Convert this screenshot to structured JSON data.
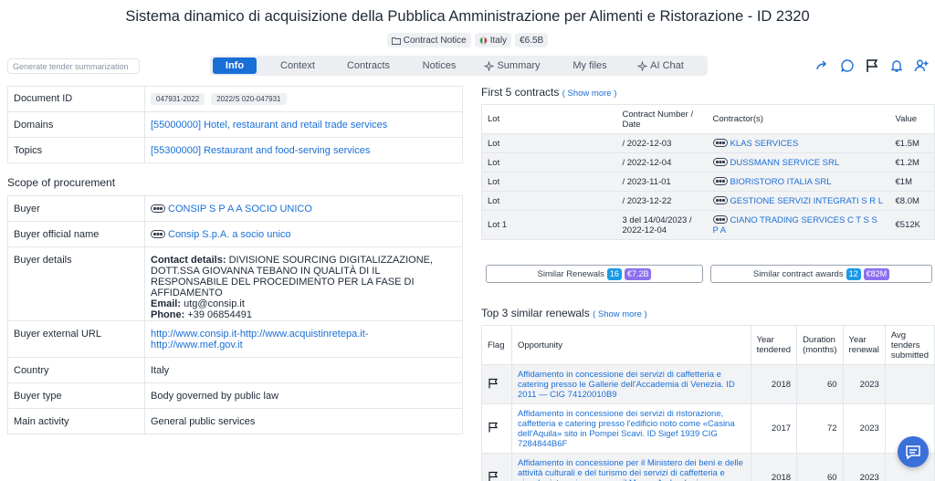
{
  "header": {
    "title": "Sistema dinamico di acquisizione della Pubblica Amministrazione per Alimenti e Ristorazione - ID 2320",
    "chips": {
      "type": "Contract Notice",
      "country": "Italy",
      "value": "€6.5B"
    }
  },
  "toolbar": {
    "generate_summary": "Generate tender summarization"
  },
  "tabs": [
    {
      "label": "Info",
      "active": true
    },
    {
      "label": "Context"
    },
    {
      "label": "Contracts"
    },
    {
      "label": "Notices"
    },
    {
      "label": "Summary"
    },
    {
      "label": "My files"
    },
    {
      "label": "AI Chat"
    }
  ],
  "details": {
    "document_id_label": "Document ID",
    "document_ids": [
      "047931-2022",
      "2022/S 020-047931"
    ],
    "domains_label": "Domains",
    "domains_value": "[55000000] Hotel, restaurant and retail trade services",
    "topics_label": "Topics",
    "topics_value": "[55300000] Restaurant and food-serving services"
  },
  "scope": {
    "heading": "Scope of procurement",
    "buyer_label": "Buyer",
    "buyer_value": "CONSIP S P A A SOCIO UNICO",
    "official_label": "Buyer official name",
    "official_value": "Consip S.p.A. a socio unico",
    "details_label": "Buyer details",
    "contact_label": "Contact details:",
    "contact_value": "DIVISIONE SOURCING DIGITALIZZAZIONE, DOTT.SSA GIOVANNA TEBANO IN QUALITÀ DI IL RESPONSABILE DEL PROCEDIMENTO PER LA FASE DI AFFIDAMENTO",
    "email_label": "Email:",
    "email_value": "utg@consip.it",
    "phone_label": "Phone:",
    "phone_value": "+39 06854491",
    "url_label": "Buyer external URL",
    "url_value": "http://www.consip.it-http://www.acquistinretepa.it-http://www.mef.gov.it",
    "country_label": "Country",
    "country_value": "Italy",
    "type_label": "Buyer type",
    "type_value": "Body governed by public law",
    "activity_label": "Main activity",
    "activity_value": "General public services"
  },
  "contracts": {
    "heading": "First 5 contracts",
    "show_more": "( Show more )",
    "columns": [
      "Lot",
      "Contract Number / Date",
      "Contractor(s)",
      "Value"
    ],
    "rows": [
      {
        "lot": "Lot",
        "date": "/ 2022-12-03",
        "contractor": "KLAS SERVICES",
        "value": "€1.5M"
      },
      {
        "lot": "Lot",
        "date": "/ 2022-12-04",
        "contractor": "DUSSMANN SERVICE SRL",
        "value": "€1.2M"
      },
      {
        "lot": "Lot",
        "date": "/ 2023-11-01",
        "contractor": "BIORISTORO ITALIA SRL",
        "value": "€1M"
      },
      {
        "lot": "Lot",
        "date": "/ 2023-12-22",
        "contractor": "GESTIONE SERVIZI INTEGRATI S R L",
        "value": "€8.0M"
      },
      {
        "lot": "Lot 1",
        "date": "3 del 14/04/2023 / 2022-12-04",
        "contractor": "CIANO TRADING SERVICES C T S S P A",
        "value": "€512K"
      }
    ]
  },
  "similar": {
    "renewals_label": "Similar Renewals",
    "renewals_count": "16",
    "renewals_value": "€7.2B",
    "awards_label": "Similar contract awards",
    "awards_count": "12",
    "awards_value": "€82M"
  },
  "renewals": {
    "heading": "Top 3 similar renewals",
    "show_more": "( Show more )",
    "columns": [
      "Flag",
      "Opportunity",
      "Year tendered",
      "Duration (months)",
      "Year renewal",
      "Avg tenders submitted"
    ],
    "rows": [
      {
        "opportunity": "Affidamento in concessione dei servizi di caffetteria e catering presso le Gallerie dell'Accademia di Venezia. ID 2011 — CIG 74120010B9",
        "year": "2018",
        "duration": "60",
        "renewal": "2023",
        "avg": ""
      },
      {
        "opportunity": "Affidamento in concessione dei servizi di ristorazione, caffetteria e catering presso l'edificio noto come «Casina dell'Aquila» sito in Pompei Scavi. ID Sigef 1939 CIG 7284844B6F",
        "year": "2017",
        "duration": "72",
        "renewal": "2023",
        "avg": ""
      },
      {
        "opportunity": "Affidamento in concessione per il Ministero dei beni e delle attività culturali e del turismo dei servizi di caffetteria e piccola ristorazione presso il Museo Archeologico Nazionale",
        "year": "2018",
        "duration": "60",
        "renewal": "2023",
        "avg": ""
      }
    ]
  },
  "colors": {
    "accent": "#1a6fd6",
    "badge_blue": "#1a9be6",
    "badge_purple": "#8b6ff0",
    "fab": "#3b6fd9"
  }
}
